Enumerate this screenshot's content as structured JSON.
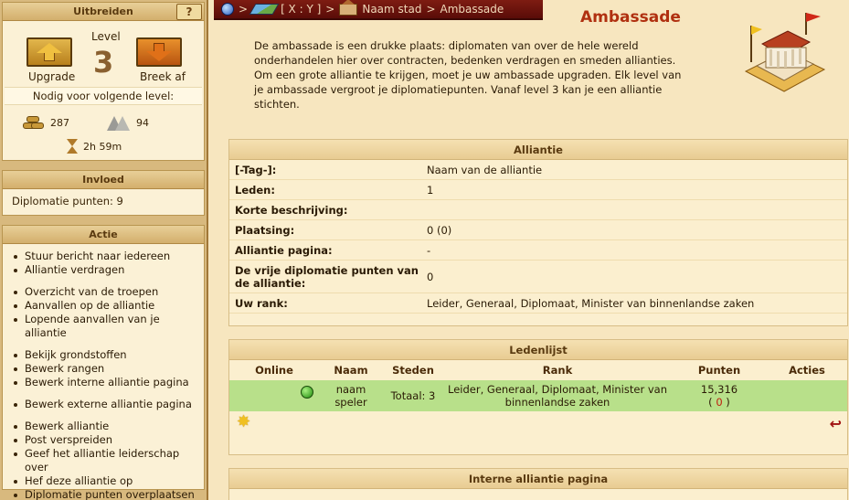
{
  "sidebar": {
    "upgrade_box": {
      "title": "Uitbreiden",
      "level_label": "Level",
      "level_value": "3",
      "upgrade_label": "Upgrade",
      "breakoff_label": "Breek af",
      "needed_label": "Nodig voor volgende level:",
      "wood": "287",
      "stone": "94",
      "time": "2h 59m"
    },
    "influence_box": {
      "title": "Invloed",
      "diplomacy_points": "Diplomatie punten: 9"
    },
    "action_box": {
      "title": "Actie",
      "items": [
        "Stuur bericht naar iedereen",
        "Alliantie verdragen",
        "Overzicht van de troepen",
        "Aanvallen op de alliantie",
        "Lopende aanvallen van je alliantie",
        "Bekijk grondstoffen",
        "Bewerk rangen",
        "Bewerk interne alliantie pagina",
        "Bewerk externe alliantie pagina",
        "Bewerk alliantie",
        "Post verspreiden",
        "Geef het alliantie leiderschap over",
        "Hef deze alliantie op",
        "Diplomatie punten overplaatsen"
      ]
    }
  },
  "breadcrumb": {
    "coords": "[ X : Y ]",
    "city": "Naam stad",
    "building": "Ambassade",
    "separator": ">"
  },
  "page": {
    "title": "Ambassade",
    "intro": "De ambassade is een drukke plaats: diplomaten van over de hele wereld onderhandelen hier over contracten, bedenken verdragen en smeden allianties. Om een grote alliantie te krijgen, moet je uw ambassade upgraden. Elk level van je ambassade vergroot je diplomatiepunten. Vanaf level 3 kan je een alliantie stichten."
  },
  "alliance": {
    "title": "Alliantie",
    "rows": [
      {
        "key": "[-Tag-]:",
        "value": "Naam van de alliantie"
      },
      {
        "key": "Leden:",
        "value": "1"
      },
      {
        "key": "Korte beschrijving:",
        "value": ""
      },
      {
        "key": "Plaatsing:",
        "value": "0 (0)"
      },
      {
        "key": "Alliantie pagina:",
        "value": "-"
      },
      {
        "key": "De vrije diplomatie punten van de alliantie:",
        "value": "0"
      },
      {
        "key": "Uw rank:",
        "value": "Leider, Generaal, Diplomaat, Minister van binnenlandse zaken"
      }
    ]
  },
  "members": {
    "title": "Ledenlijst",
    "headers": {
      "online": "Online",
      "name": "Naam",
      "towns": "Steden",
      "rank": "Rank",
      "points": "Punten",
      "actions": "Acties"
    },
    "rows": [
      {
        "name": "naam speler",
        "towns": "Totaal: 3",
        "rank": "Leider, Generaal, Diplomaat, Minister van binnenlandse zaken",
        "points": "15,316",
        "points_change": "0"
      }
    ]
  },
  "internal": {
    "title": "Interne alliantie pagina"
  },
  "colors": {
    "accent_red": "#b03010",
    "online_row": "#b8e08a",
    "breadcrumb_bg": "#7e1c12"
  }
}
